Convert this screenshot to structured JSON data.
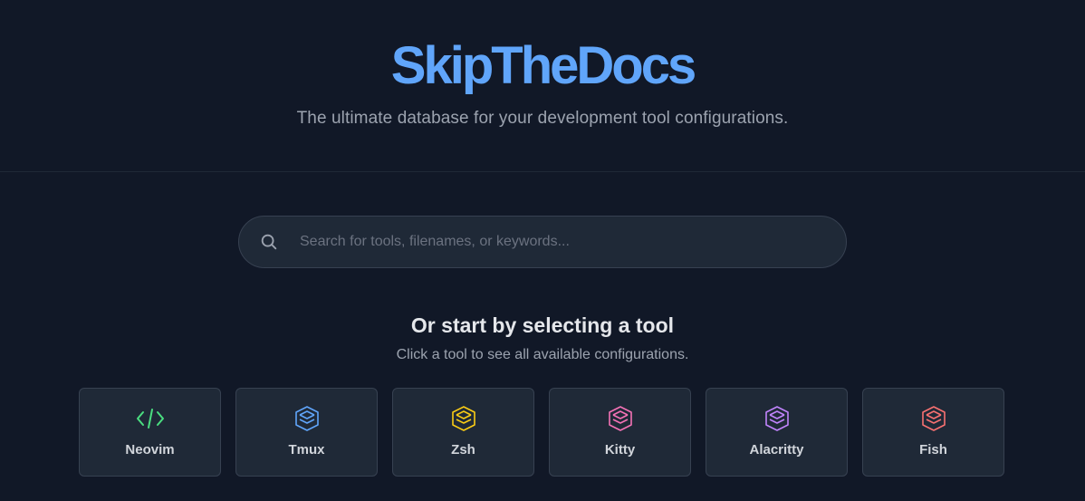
{
  "header": {
    "logo": "SkipTheDocs",
    "tagline": "The ultimate database for your development tool configurations."
  },
  "search": {
    "placeholder": "Search for tools, filenames, or keywords...",
    "value": "",
    "icon": "search-icon"
  },
  "tools_section": {
    "title": "Or start by selecting a tool",
    "subtitle": "Click a tool to see all available configurations."
  },
  "tools": [
    {
      "name": "Neovim",
      "icon": "code-icon",
      "color": "#4ade80"
    },
    {
      "name": "Tmux",
      "icon": "layers-icon",
      "color": "#60a5fa"
    },
    {
      "name": "Zsh",
      "icon": "layers-icon",
      "color": "#facc15"
    },
    {
      "name": "Kitty",
      "icon": "layers-icon",
      "color": "#f472b6"
    },
    {
      "name": "Alacritty",
      "icon": "layers-icon",
      "color": "#c084fc"
    },
    {
      "name": "Fish",
      "icon": "layers-icon",
      "color": "#f87171"
    }
  ],
  "colors": {
    "background": "#111827",
    "card": "#1f2937",
    "accent": "#60a5fa"
  }
}
